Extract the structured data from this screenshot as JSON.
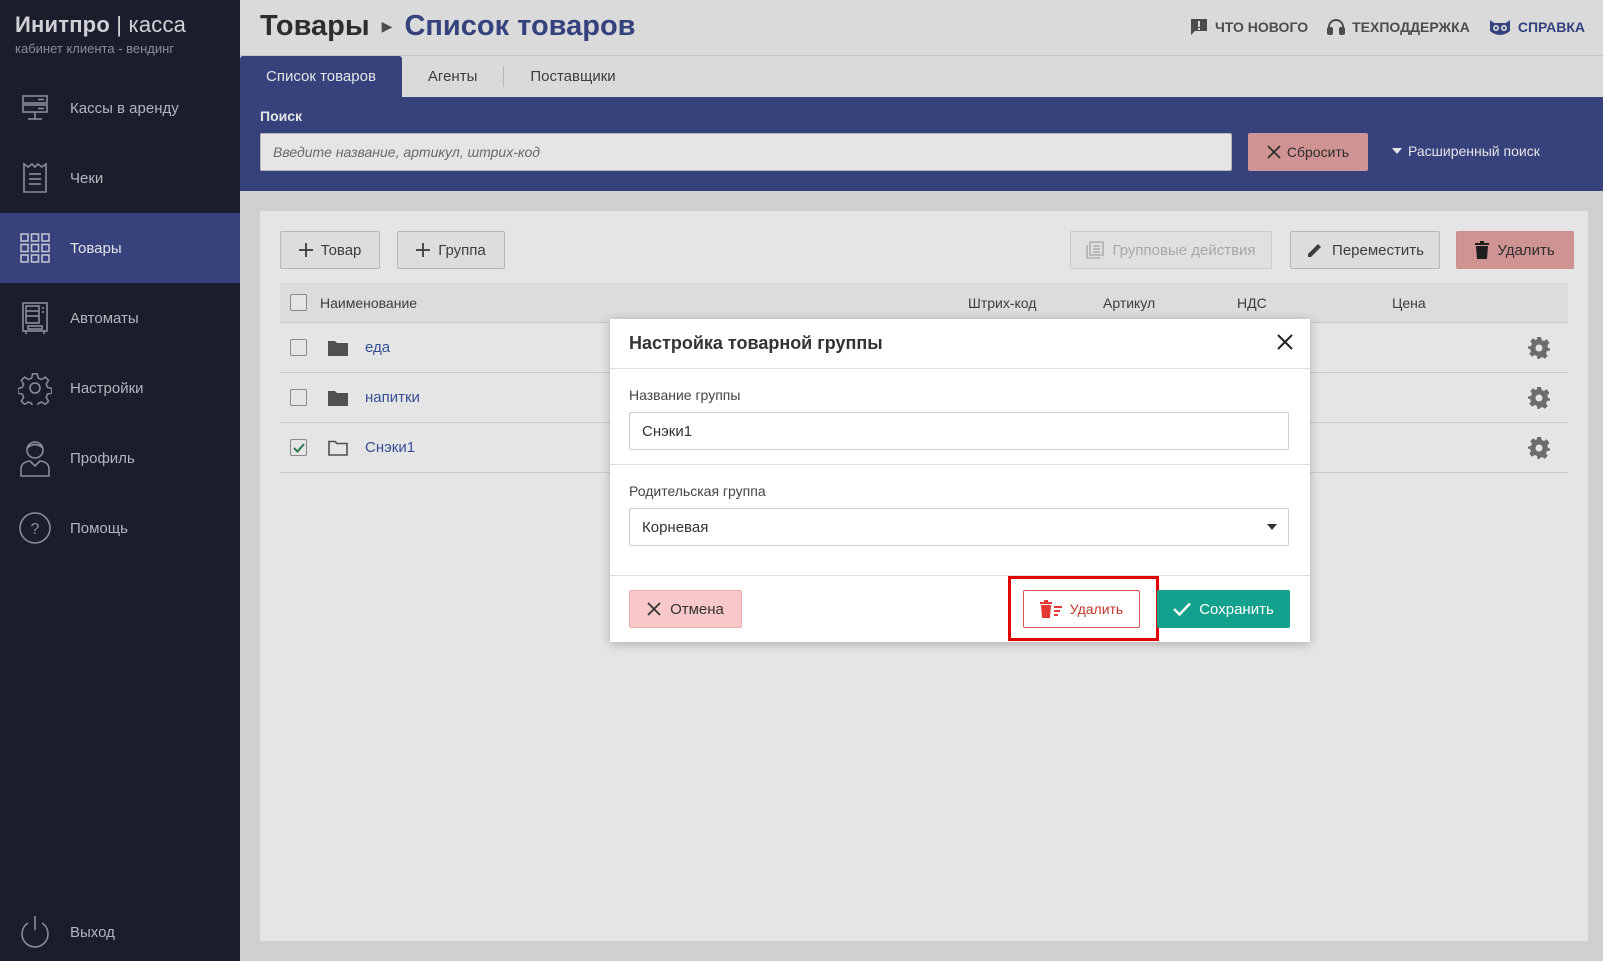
{
  "brand": {
    "name": "Инитпро",
    "sep": "|",
    "product": "касса",
    "subtitle": "кабинет клиента - вендинг"
  },
  "sidebar": {
    "items": [
      {
        "label": "Кассы в аренду",
        "icon": "server-icon"
      },
      {
        "label": "Чеки",
        "icon": "receipt-icon"
      },
      {
        "label": "Товары",
        "icon": "grid-icon",
        "active": true
      },
      {
        "label": "Автоматы",
        "icon": "vending-machine-icon"
      },
      {
        "label": "Настройки",
        "icon": "gear-icon"
      },
      {
        "label": "Профиль",
        "icon": "user-icon"
      },
      {
        "label": "Помощь",
        "icon": "help-icon"
      }
    ],
    "logout": "Выход"
  },
  "header": {
    "crumb_parent": "Товары",
    "crumb_current": "Список товаров",
    "links": {
      "whats_new": "ЧТО НОВОГО",
      "support": "ТЕХПОДДЕРЖКА",
      "help": "СПРАВКА"
    }
  },
  "tabs": [
    "Список товаров",
    "Агенты",
    "Поставщики"
  ],
  "search": {
    "label": "Поиск",
    "placeholder": "Введите название, артикул, штрих-код",
    "reset": "Сбросить",
    "advanced": "Расширенный поиск"
  },
  "toolbar": {
    "add_item": "Товар",
    "add_group": "Группа",
    "group_actions": "Групповые действия",
    "move": "Переместить",
    "delete": "Удалить"
  },
  "table": {
    "columns": {
      "name": "Наименование",
      "barcode": "Штрих-код",
      "sku": "Артикул",
      "vat": "НДС",
      "price": "Цена"
    },
    "rows": [
      {
        "name": "еда",
        "checked": false
      },
      {
        "name": "напитки",
        "checked": false
      },
      {
        "name": "Снэки1",
        "checked": true
      }
    ]
  },
  "modal": {
    "title": "Настройка товарной группы",
    "group_name_label": "Название группы",
    "group_name_value": "Снэки1",
    "parent_label": "Родительская группа",
    "parent_value": "Корневая",
    "cancel": "Отмена",
    "delete": "Удалить",
    "save": "Сохранить"
  },
  "colors": {
    "sidebar_bg": "#1e2130",
    "accent": "#3e4a8c",
    "save": "#13a08c",
    "danger": "#e8a4a4",
    "highlight": "#e00000"
  }
}
